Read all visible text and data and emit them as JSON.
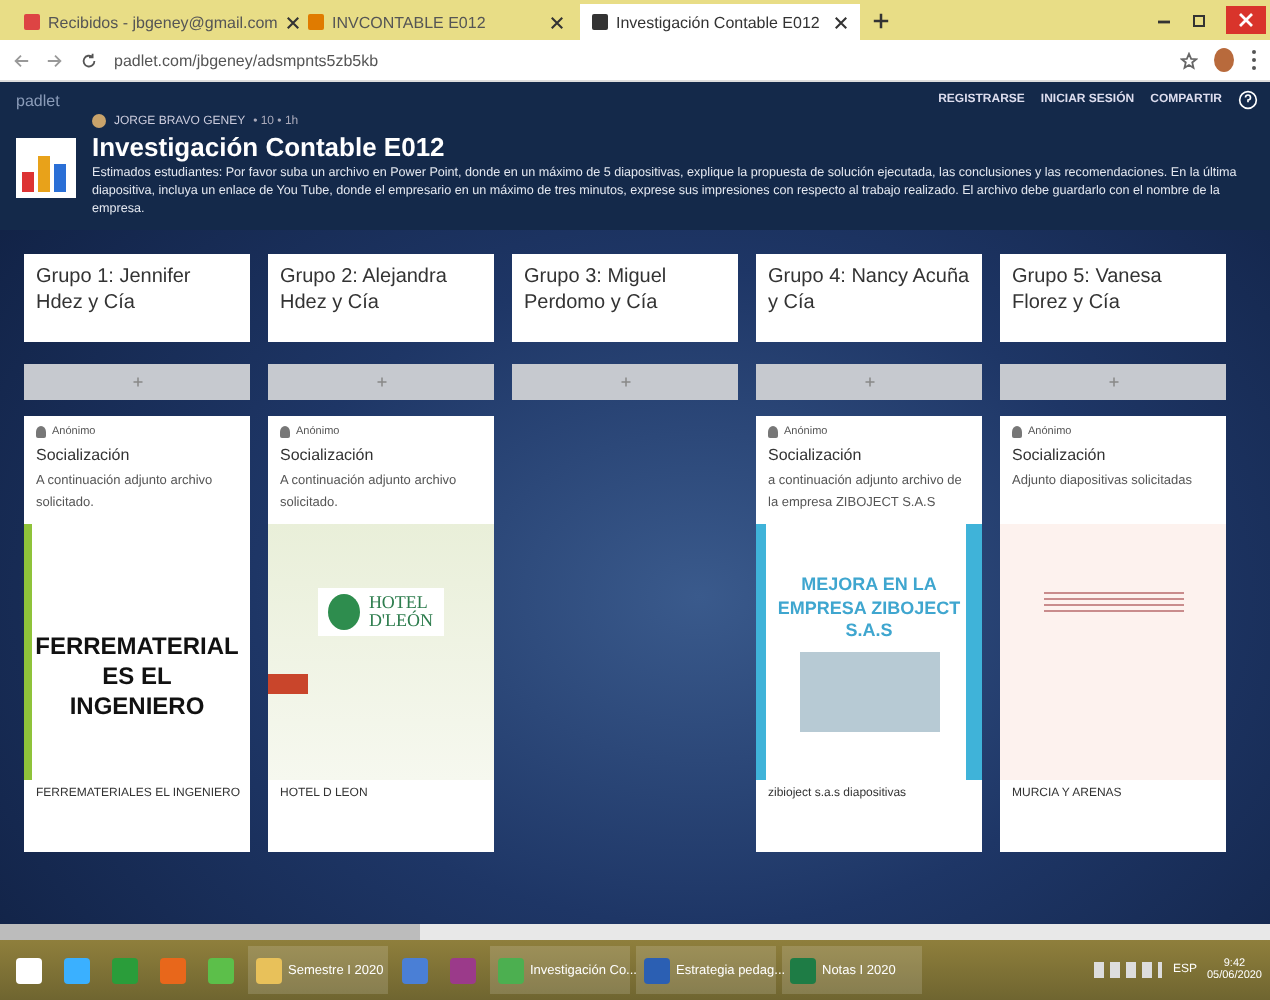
{
  "browser": {
    "tabs": [
      {
        "kind": "mail",
        "title": "Recibidos - jbgeney@gmail.com",
        "selected": false
      },
      {
        "kind": "doc",
        "title": "INVCONTABLE E012",
        "selected": false
      },
      {
        "kind": "padlet",
        "title": "Investigación Contable E012",
        "selected": true
      }
    ],
    "address": "padlet.com/jbgeney/adsmpnts5zb5kb"
  },
  "header": {
    "brand": "padlet",
    "actions": [
      "REGISTRARSE",
      "INICIAR SESIÓN",
      "COMPARTIR"
    ],
    "author": "JORGE BRAVO GENEY",
    "meta": "• 10 • 1h",
    "title": "Investigación Contable E012",
    "description": "Estimados estudiantes: Por favor suba un archivo en Power Point, donde en un máximo de 5 diapositivas, explique la propuesta de solución ejecutada, las conclusiones y las recomendaciones. En la última diapositiva, incluya un enlace de You Tube, donde el empresario en un máximo de tres minutos, exprese sus impresiones con respecto al trabajo realizado. El archivo debe guardarlo con el nombre de la empresa."
  },
  "columns": [
    {
      "title": "Grupo 1: Jennifer Hdez y Cía",
      "posts": [
        {
          "author": "Anónimo",
          "title": "Socialización",
          "body": "A continuación adjunto archivo solicitado.",
          "preview": {
            "kind": "ferre",
            "lines": [
              "FERREMATERIAL",
              "ES EL",
              "INGENIERO"
            ]
          },
          "caption": "FERREMATERIALES EL INGENIERO"
        }
      ]
    },
    {
      "title": "Grupo 2: Alejandra Hdez y Cía",
      "posts": [
        {
          "author": "Anónimo",
          "title": "Socialización",
          "body": "A continuación adjunto archivo solicitado.",
          "preview": {
            "kind": "hotel",
            "lines": [
              "HOTEL",
              "D'LEÓN"
            ]
          },
          "caption": "HOTEL D LEON"
        }
      ]
    },
    {
      "title": "Grupo 3: Miguel Perdomo y Cía"
    },
    {
      "title": "Grupo 4: Nancy Acuña y Cía",
      "posts": [
        {
          "author": "Anónimo",
          "title": "Socialización",
          "body": "a continuación adjunto archivo de la empresa ZIBOJECT S.A.S",
          "preview": {
            "kind": "mejora",
            "lines": [
              "MEJORA EN LA",
              "EMPRESA ZIBOJECT",
              "S.A.S"
            ]
          },
          "caption": "zibioject s.a.s diapositivas"
        }
      ]
    },
    {
      "title": "Grupo 5: Vanesa Florez y Cía",
      "posts": [
        {
          "author": "Anónimo",
          "title": "Socialización",
          "body": "Adjunto diapositivas solicitadas",
          "preview": {
            "kind": "plain"
          },
          "caption": "MURCIA Y ARENAS"
        }
      ]
    }
  ],
  "taskbar": {
    "items": [
      {
        "kind": "start"
      },
      {
        "kind": "ie"
      },
      {
        "kind": "store"
      },
      {
        "kind": "firefox"
      },
      {
        "kind": "app"
      },
      {
        "kind": "folder",
        "label": "Semestre I 2020"
      },
      {
        "kind": "app2"
      },
      {
        "kind": "winrar"
      },
      {
        "kind": "chrome",
        "label": "Investigación Co..."
      },
      {
        "kind": "word",
        "label": "Estrategia pedag..."
      },
      {
        "kind": "excel",
        "label": "Notas I 2020"
      }
    ],
    "lang": "ESP",
    "time": "9:42",
    "date": "05/06/2020"
  }
}
